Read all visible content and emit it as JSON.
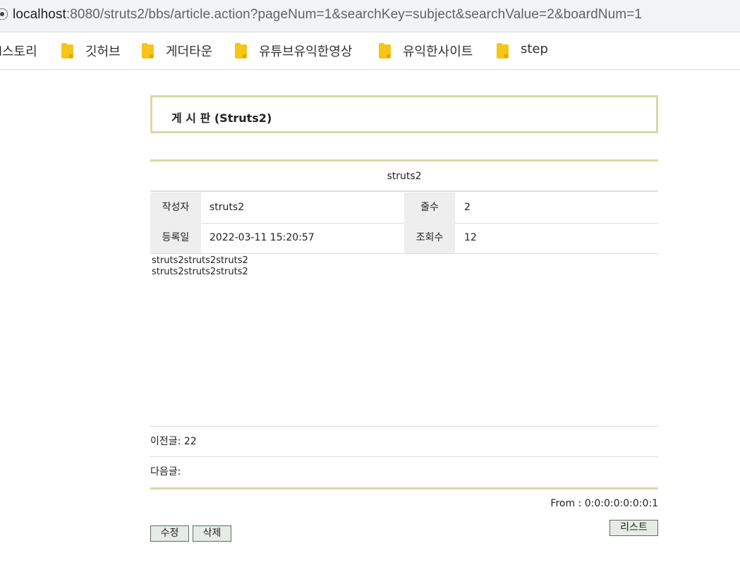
{
  "browser": {
    "url_host": "localhost",
    "url_rest": ":8080/struts2/bbs/article.action?pageNum=1&searchKey=subject&searchValue=2&boardNum=1"
  },
  "bookmarks": [
    {
      "label": "l스토리",
      "icon": "folder-icon"
    },
    {
      "label": "깃허브",
      "icon": "folder-icon"
    },
    {
      "label": "게더타운",
      "icon": "folder-icon"
    },
    {
      "label": "유튜브유익한영상",
      "icon": "folder-icon"
    },
    {
      "label": "유익한사이트",
      "icon": "folder-icon"
    },
    {
      "label": "step",
      "icon": "folder-icon"
    }
  ],
  "board": {
    "title": "게 시 판 (Struts2)"
  },
  "article": {
    "subject": "struts2",
    "author_label": "작성자",
    "author": "struts2",
    "lines_label": "줄수",
    "lines": "2",
    "created_label": "등록일",
    "created": "2022-03-11 15:20:57",
    "views_label": "조회수",
    "views": "12",
    "content_lines": [
      "struts2struts2struts2",
      "struts2struts2struts2"
    ],
    "prev_label": "이전글:",
    "prev_value": "22",
    "next_label": "다음글:",
    "next_value": "",
    "from_text": "From : 0:0:0:0:0:0:0:1"
  },
  "buttons": {
    "edit": "수정",
    "delete": "삭제",
    "list": "리스트"
  },
  "colors": {
    "accent_border": "#dad8a7",
    "label_bg": "#eeeeee",
    "button_bg": "#e5ece5",
    "folder": "#f5c518"
  }
}
